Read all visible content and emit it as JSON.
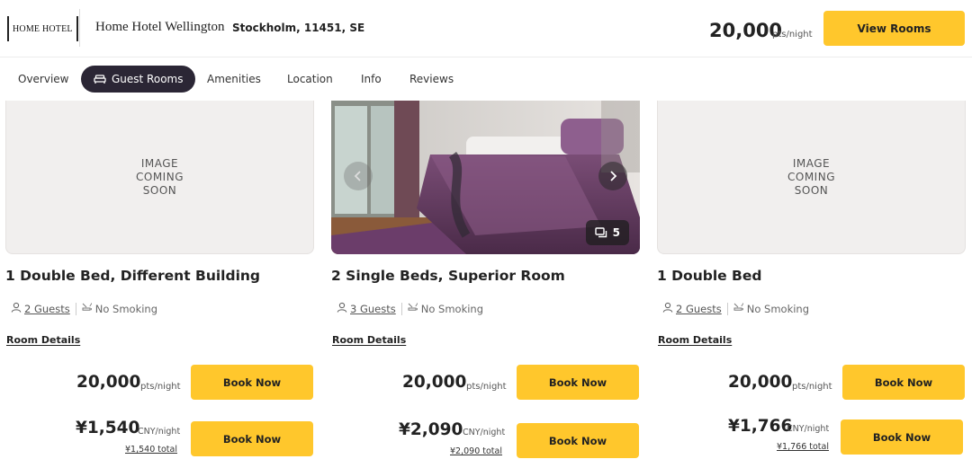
{
  "header": {
    "logo_text": "HOME HOTEL",
    "hotel_name": "Home Hotel Wellington",
    "address": "Stockholm, 11451, SE",
    "points": "20,000",
    "points_unit": "pts/night",
    "view_rooms_label": "View Rooms"
  },
  "tabs": [
    {
      "label": "Overview",
      "active": false
    },
    {
      "label": "Guest Rooms",
      "active": true,
      "icon": "bed-icon"
    },
    {
      "label": "Amenities",
      "active": false
    },
    {
      "label": "Location",
      "active": false
    },
    {
      "label": "Info",
      "active": false
    },
    {
      "label": "Reviews",
      "active": false
    }
  ],
  "rooms": [
    {
      "title": "1 Double Bed, Different Building",
      "image_placeholder": [
        "IMAGE",
        "COMING",
        "SOON"
      ],
      "guests": "2 Guests",
      "smoking": "No Smoking",
      "details_label": "Room Details",
      "points": "20,000",
      "points_unit": "pts/night",
      "book_label": "Book Now",
      "cash": "¥1,540",
      "cash_unit": "CNY/night",
      "cash_total": "¥1,540 total"
    },
    {
      "title": "2 Single Beds, Superior Room",
      "photo_count": "5",
      "guests": "3 Guests",
      "smoking": "No Smoking",
      "details_label": "Room Details",
      "points": "20,000",
      "points_unit": "pts/night",
      "book_label": "Book Now",
      "cash": "¥2,090",
      "cash_unit": "CNY/night",
      "cash_total": "¥2,090 total"
    },
    {
      "title": "1 Double Bed",
      "image_placeholder": [
        "IMAGE",
        "COMING",
        "SOON"
      ],
      "guests": "2 Guests",
      "smoking": "No Smoking",
      "details_label": "Room Details",
      "points": "20,000",
      "points_unit": "pts/night",
      "book_label": "Book Now",
      "cash": "¥1,766",
      "cash_unit": "CNY/night",
      "cash_total": "¥1,766 total"
    }
  ],
  "colors": {
    "accent": "#ffc72c",
    "active_tab": "#2b2635",
    "placeholder_bg": "#f1efee"
  }
}
